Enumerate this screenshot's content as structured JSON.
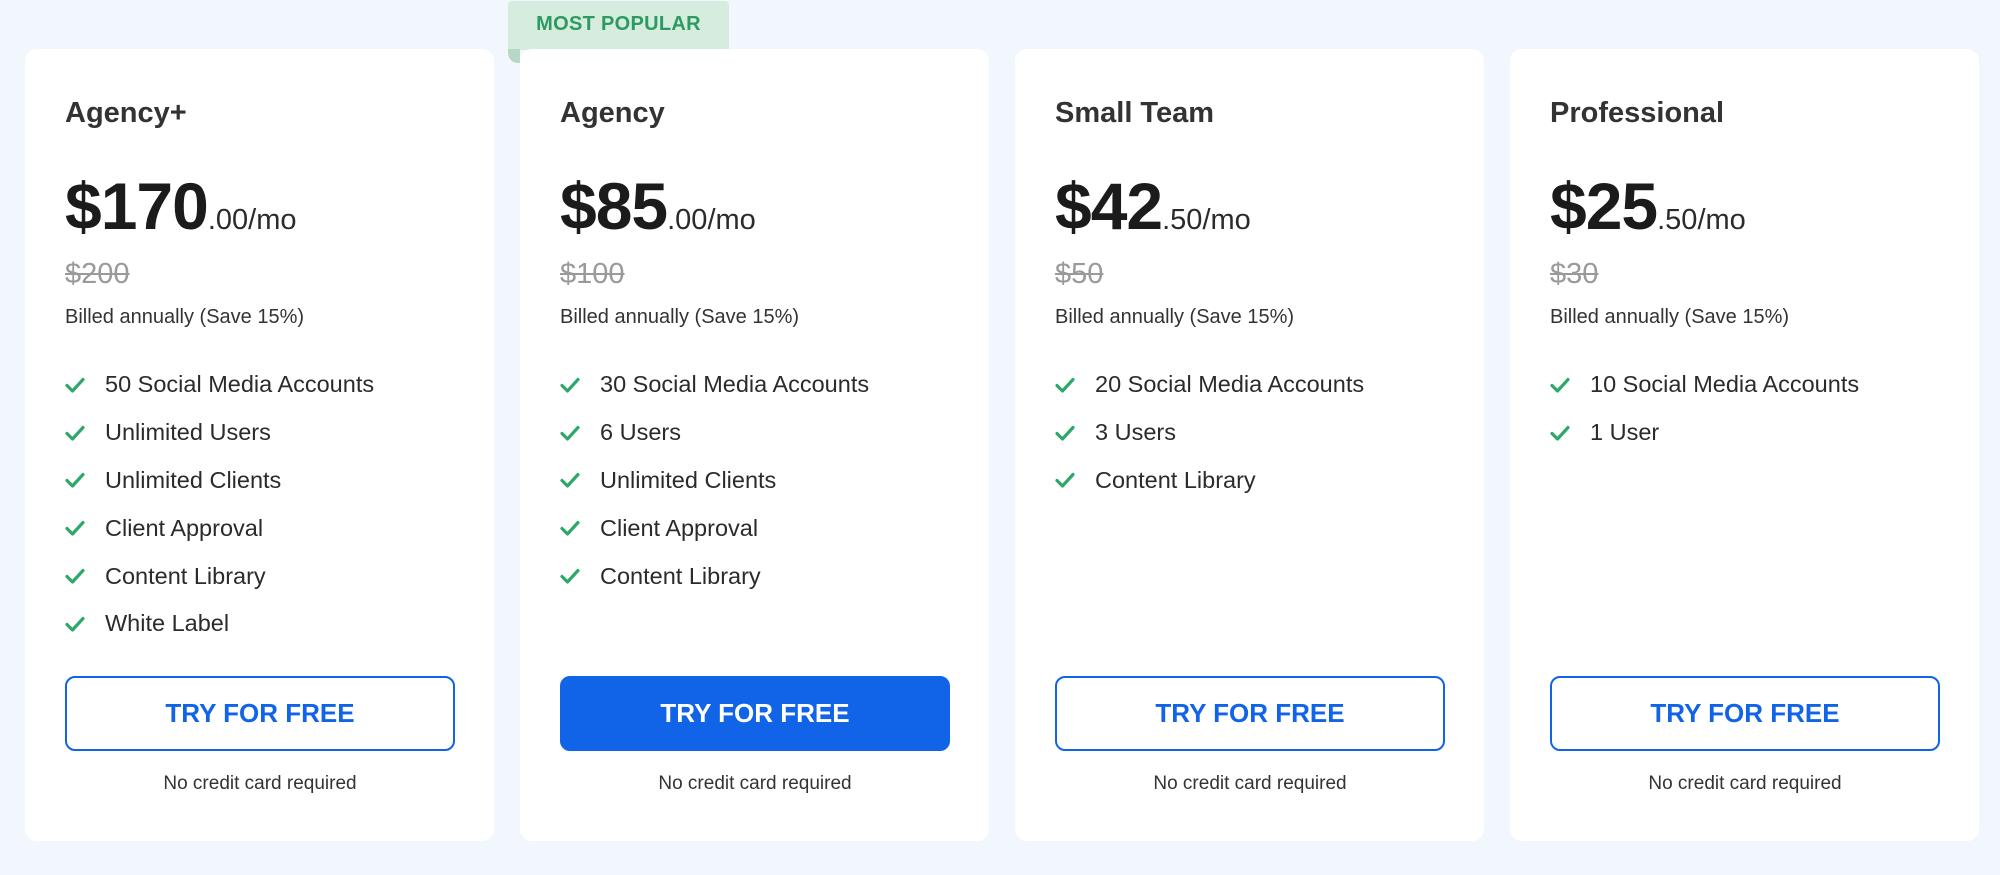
{
  "badge": {
    "label": "MOST POPULAR"
  },
  "plans": [
    {
      "name": "Agency+",
      "price_main": "$170",
      "price_suffix": ".00/mo",
      "old_price": "$200",
      "billing": "Billed annually (Save 15%)",
      "features": [
        "50 Social Media Accounts",
        "Unlimited Users",
        "Unlimited Clients",
        "Client Approval",
        "Content Library",
        "White Label"
      ],
      "cta_label": "TRY FOR FREE",
      "note": "No credit card required"
    },
    {
      "name": "Agency",
      "price_main": "$85",
      "price_suffix": ".00/mo",
      "old_price": "$100",
      "billing": "Billed annually (Save 15%)",
      "features": [
        "30 Social Media Accounts",
        "6 Users",
        "Unlimited Clients",
        "Client Approval",
        "Content Library"
      ],
      "cta_label": "TRY FOR FREE",
      "note": "No credit card required"
    },
    {
      "name": "Small Team",
      "price_main": "$42",
      "price_suffix": ".50/mo",
      "old_price": "$50",
      "billing": "Billed annually (Save 15%)",
      "features": [
        "20 Social Media Accounts",
        "3 Users",
        "Content Library"
      ],
      "cta_label": "TRY FOR FREE",
      "note": "No credit card required"
    },
    {
      "name": "Professional",
      "price_main": "$25",
      "price_suffix": ".50/mo",
      "old_price": "$30",
      "billing": "Billed annually (Save 15%)",
      "features": [
        "10 Social Media Accounts",
        "1 User"
      ],
      "cta_label": "TRY FOR FREE",
      "note": "No credit card required"
    }
  ],
  "icons": {
    "feature": "check-icon"
  },
  "colors": {
    "page_bg": "#f2f6fd",
    "accent": "#1164e8",
    "check": "#2ea86a",
    "badge_bg": "#d6ecdf",
    "badge_text": "#2c9a62"
  }
}
